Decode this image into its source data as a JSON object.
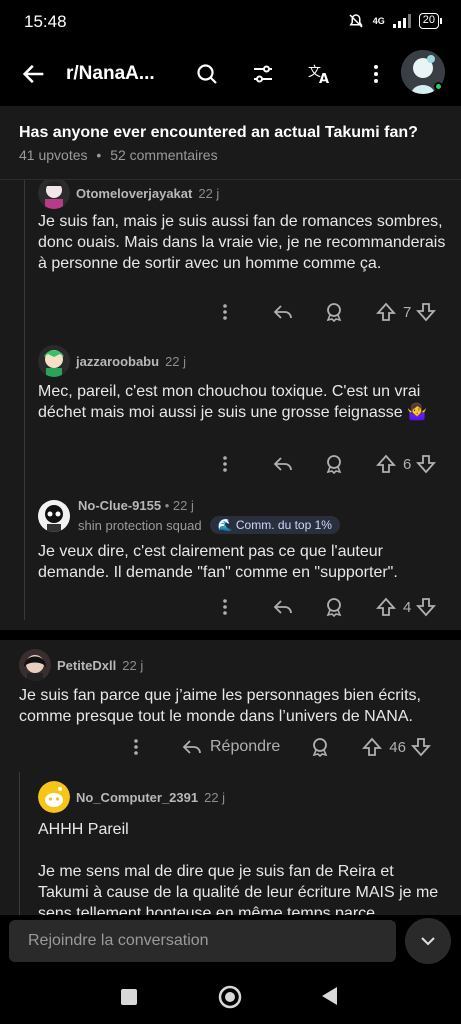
{
  "status": {
    "time": "15:48",
    "network": "4G",
    "battery": "20"
  },
  "appbar": {
    "subreddit": "r/NanaA..."
  },
  "post": {
    "title": "Has anyone ever encountered an actual Takumi fan?",
    "upvotes": "41 upvotes",
    "dot": "•",
    "comments": "52 commentaires"
  },
  "comments": [
    {
      "user": "Otomeloverjayakat",
      "age": "22 j",
      "body": "Je suis fan, mais je suis aussi fan de romances sombres, donc ouais. Mais dans la vraie vie, je ne recommanderais à personne de sortir avec un homme comme ça.",
      "votes": "7"
    },
    {
      "user": "jazzaroobabu",
      "age": "22 j",
      "body": "Mec, pareil, c'est mon chouchou toxique. C'est un vrai déchet mais moi aussi je suis une grosse feignasse 🤷‍♀️",
      "votes": "6"
    },
    {
      "user": "No-Clue-9155",
      "age": "• 22 j",
      "flair": "shin protection squad",
      "badge": "Comm. du top 1%",
      "body": "Je veux dire, c'est clairement pas ce que l'auteur demande. Il demande \"fan\" comme en \"supporter\".",
      "votes": "4"
    },
    {
      "user": "PetiteDxll",
      "age": "22 j",
      "body": "Je suis fan parce que j’aime les personnages bien écrits, comme presque tout le monde dans l’univers de NANA.",
      "reply": "Répondre",
      "votes": "46"
    },
    {
      "user": "No_Computer_2391",
      "age": "22 j",
      "body1": "AHHH Pareil",
      "body2": "Je me sens mal de dire que je suis fan de Reira et Takumi à cause de la qualité de leur écriture MAIS je me sens tellement honteuse en même temps parce"
    }
  ],
  "bottom": {
    "placeholder": "Rejoindre la conversation"
  },
  "colors": {
    "background": "#1a1a1b",
    "online": "#2ecc71"
  }
}
